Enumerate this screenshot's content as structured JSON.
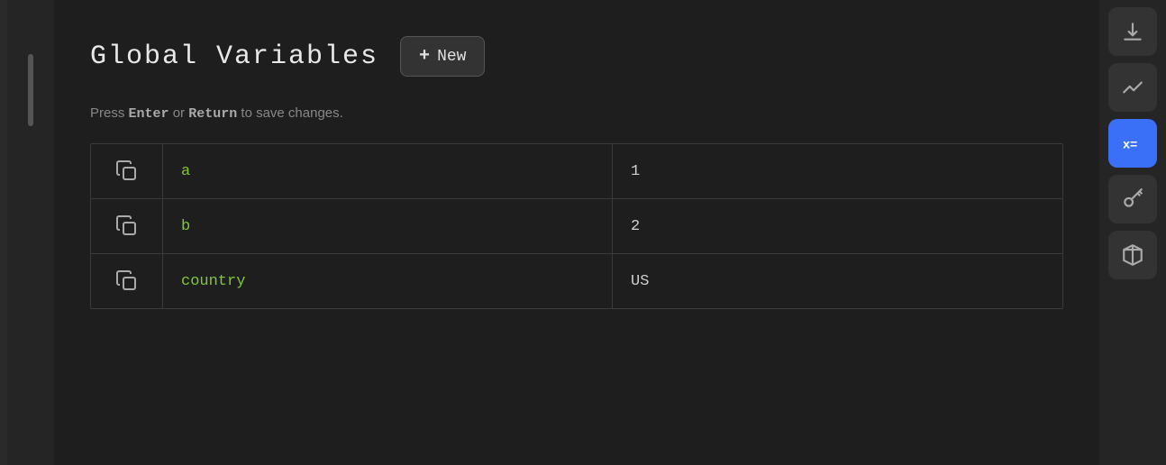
{
  "page": {
    "title": "Global Variables",
    "new_button_label": "New",
    "hint_text_prefix": "Press ",
    "hint_enter": "Enter",
    "hint_middle": " or ",
    "hint_return": "Return",
    "hint_suffix": " to save changes."
  },
  "variables": [
    {
      "id": "var-a",
      "name": "a",
      "value": "1"
    },
    {
      "id": "var-b",
      "name": "b",
      "value": "2"
    },
    {
      "id": "var-country",
      "name": "country",
      "value": "US"
    }
  ],
  "sidebar": {
    "icons": [
      {
        "name": "download-icon",
        "symbol": "↓"
      },
      {
        "name": "chart-icon",
        "symbol": "chart"
      },
      {
        "name": "variables-icon",
        "symbol": "x="
      },
      {
        "name": "key-icon",
        "symbol": "key"
      },
      {
        "name": "box-icon",
        "symbol": "box"
      }
    ]
  }
}
